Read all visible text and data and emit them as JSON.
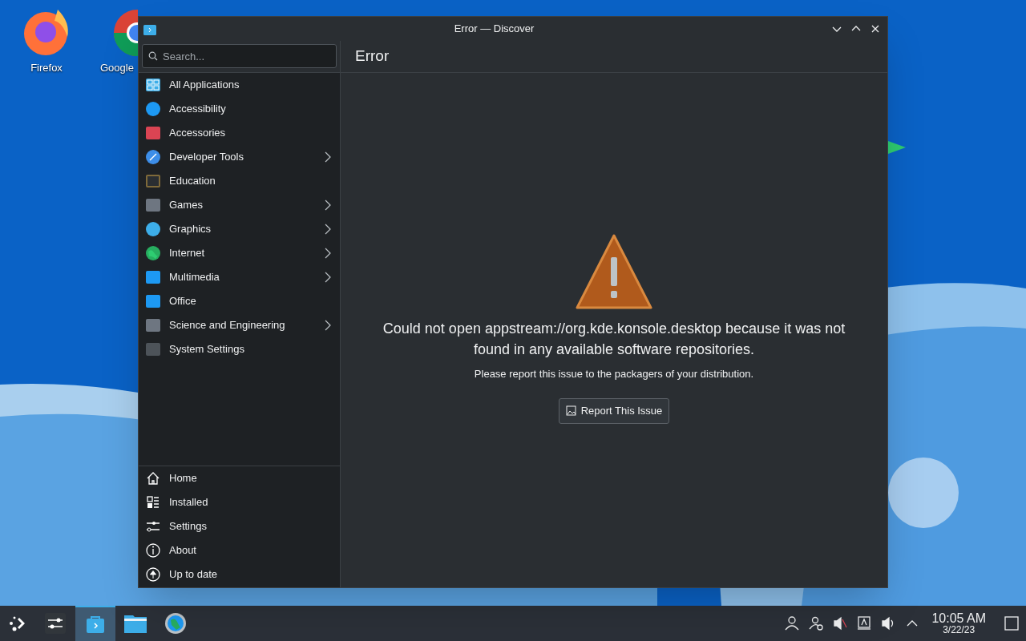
{
  "desktop": {
    "icons": [
      {
        "label": "Firefox"
      },
      {
        "label": "Google"
      }
    ]
  },
  "window": {
    "title": "Error — Discover",
    "search": {
      "placeholder": "Search..."
    },
    "categories": [
      {
        "label": "All Applications",
        "has_children": false
      },
      {
        "label": "Accessibility",
        "has_children": false
      },
      {
        "label": "Accessories",
        "has_children": false
      },
      {
        "label": "Developer Tools",
        "has_children": true
      },
      {
        "label": "Education",
        "has_children": false
      },
      {
        "label": "Games",
        "has_children": true
      },
      {
        "label": "Graphics",
        "has_children": true
      },
      {
        "label": "Internet",
        "has_children": true
      },
      {
        "label": "Multimedia",
        "has_children": true
      },
      {
        "label": "Office",
        "has_children": false
      },
      {
        "label": "Science and Engineering",
        "has_children": true
      },
      {
        "label": "System Settings",
        "has_children": false
      }
    ],
    "nav": [
      {
        "label": "Home",
        "kind": "home"
      },
      {
        "label": "Installed",
        "kind": "installed"
      },
      {
        "label": "Settings",
        "kind": "settings"
      },
      {
        "label": "About",
        "kind": "about"
      },
      {
        "label": "Up to date",
        "kind": "update"
      }
    ],
    "page_title": "Error",
    "message": "Could not open appstream://org.kde.konsole.desktop because it was not found in any available software repositories.",
    "hint": "Please report this issue to the packagers of your distribution.",
    "button": "Report This Issue"
  },
  "taskbar": {
    "tasks": [
      {
        "kind": "launcher",
        "selected": false
      },
      {
        "kind": "mixer",
        "selected": false
      },
      {
        "kind": "discover",
        "selected": true
      },
      {
        "kind": "files",
        "selected": false
      },
      {
        "kind": "browser",
        "selected": false
      }
    ],
    "time": "10:05 AM",
    "date": "3/22/23"
  }
}
